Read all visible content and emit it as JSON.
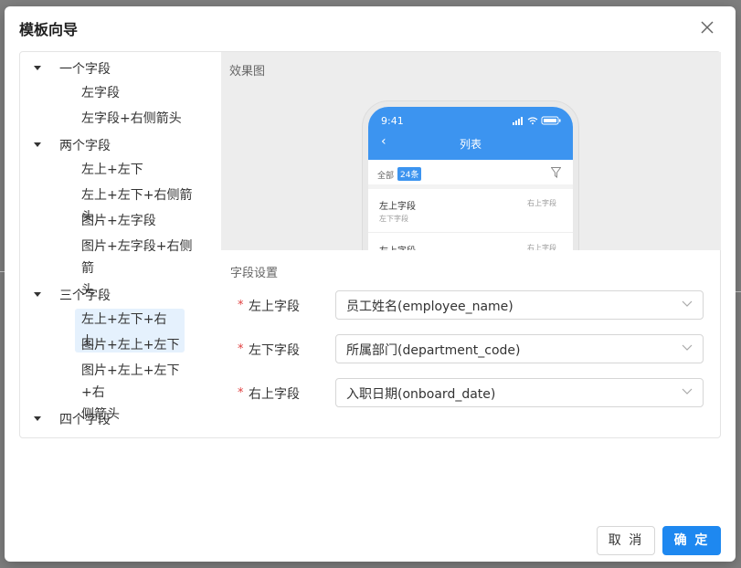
{
  "dialog": {
    "title": "模板向导",
    "close_icon": "close-icon"
  },
  "tree": {
    "groups": [
      {
        "label": "一个字段",
        "children": [
          "左字段",
          "左字段+右侧箭头"
        ]
      },
      {
        "label": "两个字段",
        "children": [
          "左上+左下",
          "左上+左下+右侧箭头",
          "图片+左字段",
          "图片+左字段+右侧箭头"
        ]
      },
      {
        "label": "三个字段",
        "children": [
          "左上+左下+右上",
          "图片+左上+左下",
          "图片+左上+左下+右侧箭头"
        ]
      },
      {
        "label": "四个字段",
        "children": []
      }
    ],
    "selected": "左上+左下+右上",
    "leaf_wrap": {
      "g2_l4_line1": "图片+左字段+右侧箭",
      "g2_l4_line2": "头",
      "g3_l3_line1": "图片+左上+左下+右",
      "g3_l3_line2": "侧箭头"
    }
  },
  "preview": {
    "label": "效果图",
    "phone": {
      "time": "9:41",
      "back_icon": "‹",
      "title": "列表",
      "filter_all": "全部",
      "filter_count": "24条",
      "filter_icon": "filter-icon",
      "rows": [
        {
          "top_left": "左上字段",
          "bottom_left": "左下字段",
          "top_right": "右上字段"
        },
        {
          "top_left": "左上字段",
          "bottom_left": "",
          "top_right": "右上字段"
        }
      ]
    }
  },
  "settings": {
    "title": "字段设置",
    "required_mark": "*",
    "fields": [
      {
        "label": "左上字段",
        "value": "员工姓名(employee_name)"
      },
      {
        "label": "左下字段",
        "value": "所属部门(department_code)"
      },
      {
        "label": "右上字段",
        "value": "入职日期(onboard_date)"
      }
    ]
  },
  "footer": {
    "cancel": "取 消",
    "ok": "确 定"
  },
  "colors": {
    "primary": "#1e88f0",
    "phone_header": "#3c94f0",
    "selected_bg": "#e5f1fd",
    "required": "#e04040"
  }
}
